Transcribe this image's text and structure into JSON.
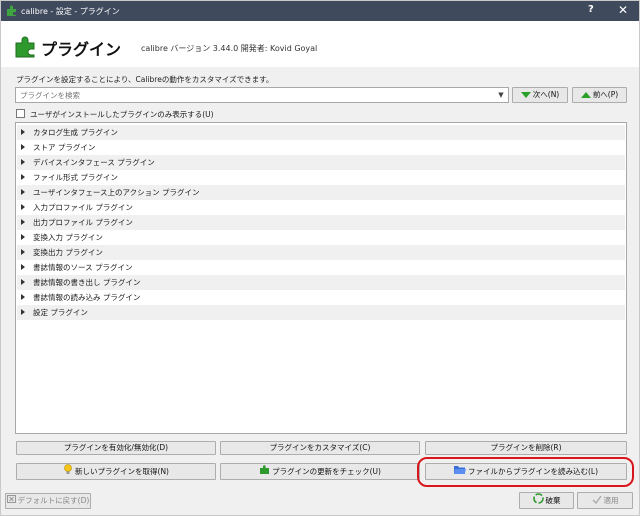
{
  "window": {
    "title": "calibre - 設定 - プラグイン",
    "help_glyph": "?",
    "close_glyph": "✕"
  },
  "header": {
    "title": "プラグイン",
    "version_text": "calibre バージョン 3.44.0 開発者: Kovid Goyal"
  },
  "description": "プラグインを設定することにより、Calibreの動作をカスタマイズできます。",
  "search": {
    "placeholder": "プラグインを検索",
    "value": "",
    "next_label": "次へ(N)",
    "prev_label": "前へ(P)"
  },
  "user_only_checkbox": {
    "label": "ユーザがインストールしたプラグインのみ表示する(U)",
    "checked": false
  },
  "plugin_categories": [
    "カタログ生成 プラグイン",
    "ストア プラグイン",
    "デバイスインタフェース プラグイン",
    "ファイル形式 プラグイン",
    "ユーザインタフェース上のアクション プラグイン",
    "入力プロファイル プラグイン",
    "出力プロファイル プラグイン",
    "変換入力 プラグイン",
    "変換出力 プラグイン",
    "書誌情報のソース プラグイン",
    "書誌情報の書き出し プラグイン",
    "書誌情報の読み込み プラグイン",
    "設定 プラグイン"
  ],
  "actions": {
    "toggle_label": "プラグインを有効化/無効化(D)",
    "customize_label": "プラグインをカスタマイズ(C)",
    "remove_label": "プラグインを削除(R)",
    "get_new_label": "新しいプラグインを取得(N)",
    "check_updates_label": "プラグインの更新をチェック(U)",
    "load_from_file_label": "ファイルからプラグインを読み込む(L)"
  },
  "footer": {
    "restore_defaults_label": "デフォルトに戻す(D)",
    "discard_label": "破棄",
    "apply_label": "適用"
  },
  "colors": {
    "titlebar": "#3f4a5c",
    "highlight": "#d8161b",
    "green_arrow": "#2aa02a"
  }
}
